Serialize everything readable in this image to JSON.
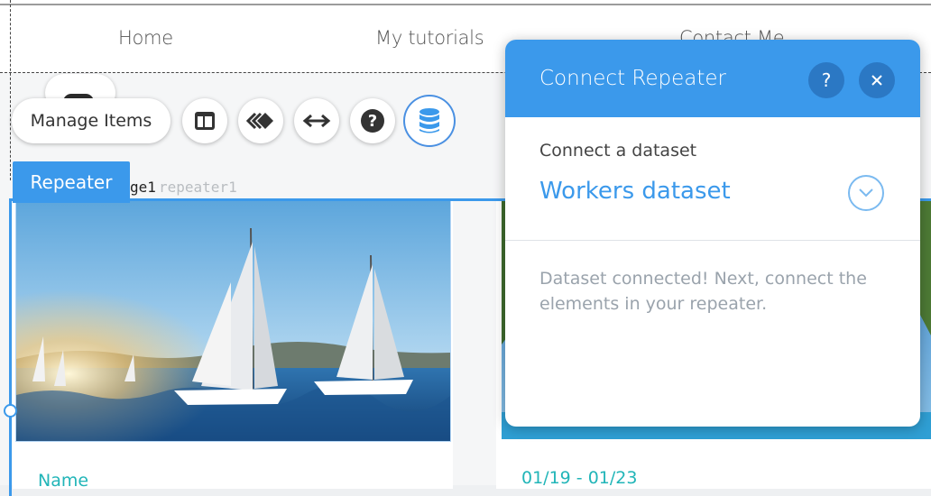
{
  "site_nav": {
    "items": [
      {
        "label": "Home"
      },
      {
        "label": "My tutorials"
      },
      {
        "label": "Contact Me"
      }
    ]
  },
  "toolbar": {
    "manage_items_label": "Manage Items",
    "tools": [
      {
        "icon": "layout-icon"
      },
      {
        "icon": "design-icon"
      },
      {
        "icon": "stretch-icon"
      },
      {
        "icon": "help-icon"
      },
      {
        "icon": "database-icon",
        "active": true
      }
    ]
  },
  "repeater": {
    "tag_label": "Repeater",
    "element_id_fragment": "ge1",
    "element_id": "repeater1",
    "cards": [
      {
        "field_label": "Name"
      },
      {
        "field_label": "01/19 - 01/23"
      }
    ]
  },
  "panel": {
    "title": "Connect Repeater",
    "help_glyph": "?",
    "dataset_label": "Connect a dataset",
    "dataset_value": "Workers dataset",
    "message": "Dataset connected! Next, connect the elements in your repeater."
  },
  "colors": {
    "accent": "#3b99eb",
    "accent_dark": "#2b78c4",
    "field_teal": "#21b5b8",
    "muted_text": "#9aa3ac"
  }
}
